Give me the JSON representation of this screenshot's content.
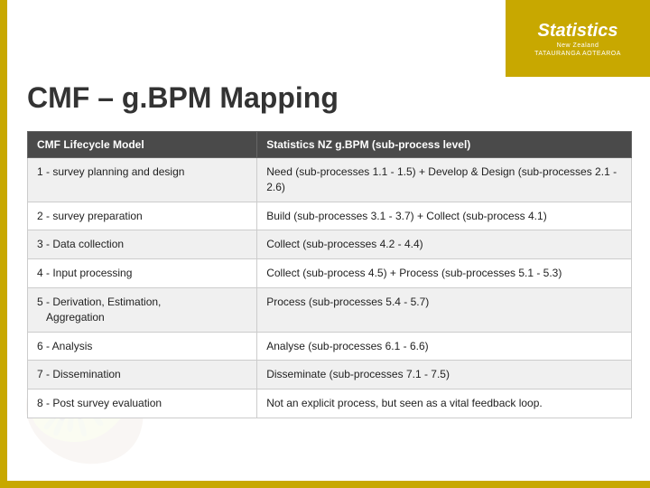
{
  "page": {
    "title": "CMF – g.BPM Mapping"
  },
  "logo": {
    "brand": "Statistics",
    "sub1": "New Zealand",
    "sub2": "TATAURANGA AOTEAROA"
  },
  "table": {
    "headers": [
      "CMF Lifecycle Model",
      "Statistics NZ g.BPM (sub-process level)"
    ],
    "rows": [
      {
        "col1": "1 - survey planning and design",
        "col2": "Need (sub-processes 1.1 - 1.5) + Develop & Design (sub-processes 2.1 - 2.6)"
      },
      {
        "col1": "2 - survey preparation",
        "col2": "Build (sub-processes 3.1 - 3.7) + Collect (sub-process 4.1)"
      },
      {
        "col1": "3 - Data collection",
        "col2": "Collect (sub-processes 4.2 - 4.4)"
      },
      {
        "col1": "4 - Input processing",
        "col2": "Collect (sub-process 4.5) + Process (sub-processes 5.1 - 5.3)"
      },
      {
        "col1": "5 - Derivation, Estimation,\n   Aggregation",
        "col2": "Process (sub-processes 5.4 - 5.7)"
      },
      {
        "col1": "6 - Analysis",
        "col2": "Analyse (sub-processes 6.1 - 6.6)"
      },
      {
        "col1": "7 - Dissemination",
        "col2": "Disseminate (sub-processes 7.1 - 7.5)"
      },
      {
        "col1": "8 - Post survey evaluation",
        "col2": "Not an explicit process, but seen as a vital feedback loop."
      }
    ]
  }
}
